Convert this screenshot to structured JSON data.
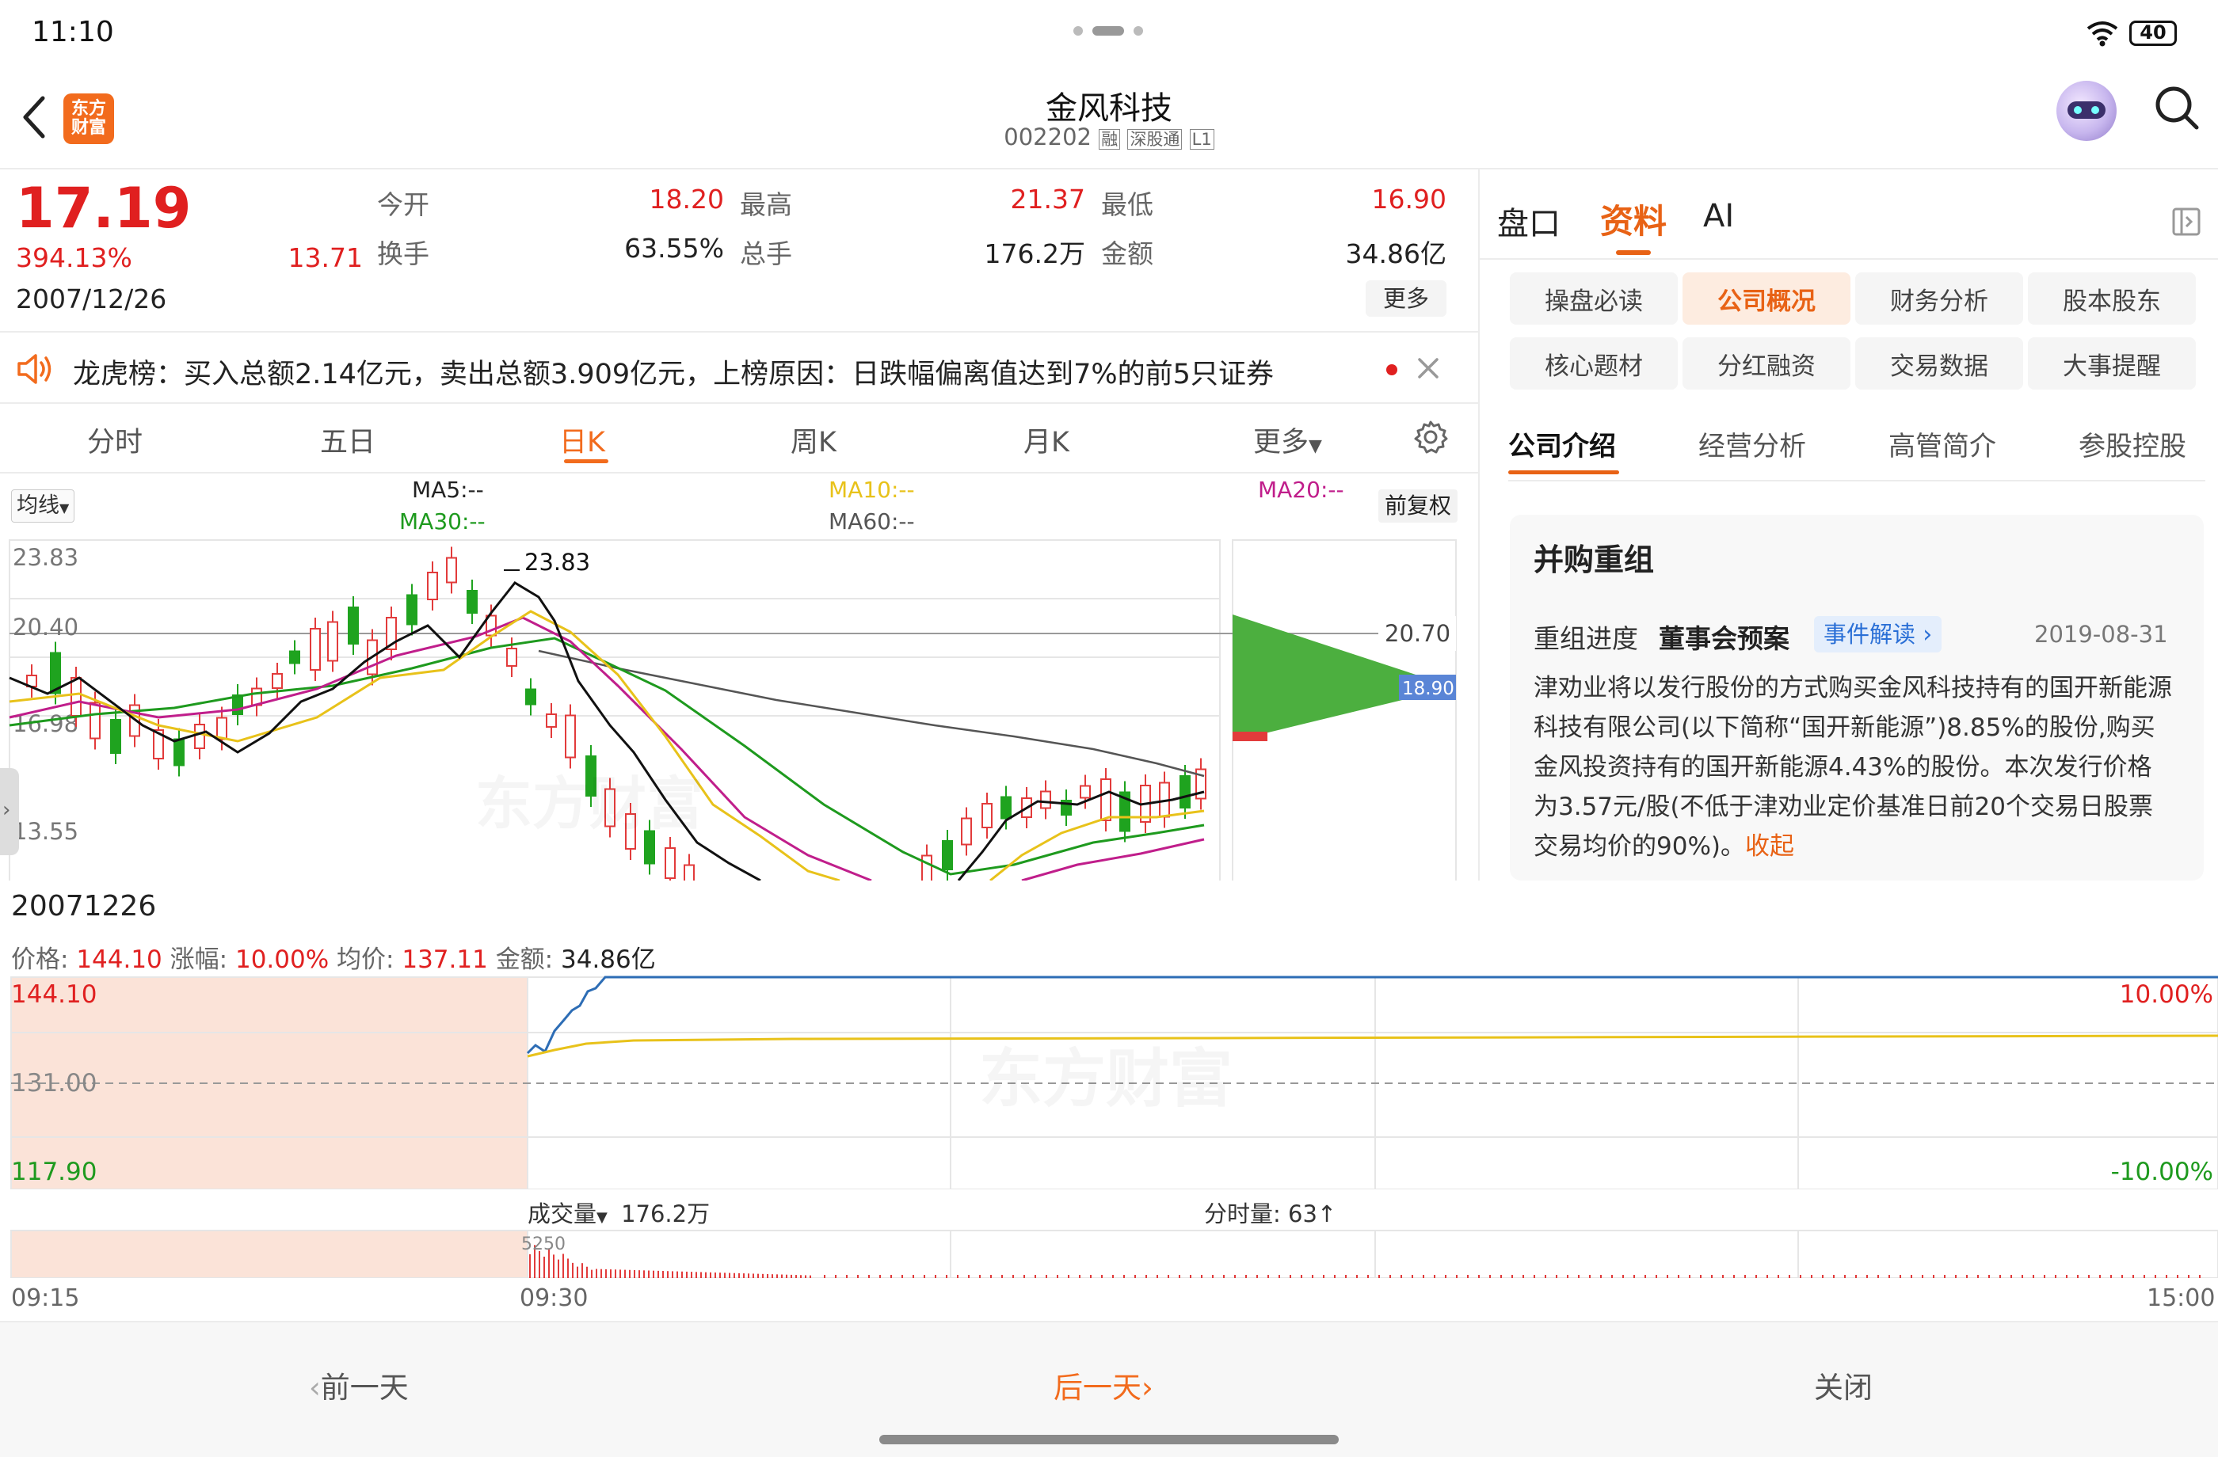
{
  "status_bar": {
    "time": "11:10",
    "battery": "40"
  },
  "header": {
    "logo_text": "东方财富",
    "title": "金风科技",
    "code": "002202",
    "badges": [
      "融",
      "深股通",
      "L1"
    ]
  },
  "quote": {
    "price": "17.19",
    "change_pct": "394.13%",
    "change": "13.71",
    "date": "2007/12/26",
    "open_label": "今开",
    "open": "18.20",
    "high_label": "最高",
    "high": "21.37",
    "low_label": "最低",
    "low": "16.90",
    "turnover_label": "换手",
    "turnover": "63.55%",
    "volume_label": "总手",
    "volume": "176.2万",
    "amount_label": "金额",
    "amount": "34.86亿",
    "more": "更多"
  },
  "notice": {
    "text": "龙虎榜：买入总额2.14亿元，卖出总额3.909亿元，上榜原因：日跌幅偏离值达到7%的前5只证券"
  },
  "chart_tabs": [
    "分时",
    "五日",
    "日K",
    "周K",
    "月K",
    "更多"
  ],
  "ma_bar": {
    "selector": "均线",
    "ma5": "MA5:--",
    "ma10": "MA10:--",
    "ma20": "MA20:--",
    "ma30": "MA30:--",
    "ma60": "MA60:--",
    "adjust": "前复权"
  },
  "kline": {
    "y_labels": [
      "23.83",
      "20.40",
      "16.98",
      "13.55"
    ],
    "max_annotation": "23.83",
    "price_line_label": "20.70",
    "current_label": "18.90"
  },
  "right_panel": {
    "tabs": [
      "盘口",
      "资料",
      "AI"
    ],
    "chips": [
      "操盘必读",
      "公司概况",
      "财务分析",
      "股本股东",
      "核心题材",
      "分红融资",
      "交易数据",
      "大事提醒"
    ],
    "sub_tabs": [
      "公司介绍",
      "经营分析",
      "高管简介",
      "参股控股"
    ],
    "section_title": "并购重组",
    "progress_label": "重组进度",
    "progress_value": "董事会预案",
    "event_button": "事件解读",
    "event_date": "2019-08-31",
    "body": "津劝业将以发行股份的方式购买金风科技持有的国开新能源科技有限公司(以下简称“国开新能源”)8.85%的股份,购买金风投资持有的国开新能源4.43%的股份。本次发行价格为3.57元/股(不低于津劝业定价基准日前20个交易日股票交易均价的90%)。",
    "collapse": "收起"
  },
  "intraday": {
    "date": "20071226",
    "price_label": "价格:",
    "price": "144.10",
    "chg_label": "涨幅:",
    "chg": "10.00%",
    "avg_label": "均价:",
    "avg": "137.11",
    "amt_label": "金额:",
    "amt": "34.86亿",
    "y_top": "144.10",
    "y_mid": "131.00",
    "y_bottom": "117.90",
    "pct_top": "10.00%",
    "pct_bottom": "-10.00%",
    "vol_selector": "成交量",
    "vol": "176.2万",
    "tick_label": "分时量:",
    "tick_value": "63↑",
    "vol_max": "5250",
    "times": [
      "09:15",
      "09:30",
      "15:00"
    ]
  },
  "bottom_nav": {
    "prev": "前一天",
    "next": "后一天",
    "close": "关闭"
  }
}
